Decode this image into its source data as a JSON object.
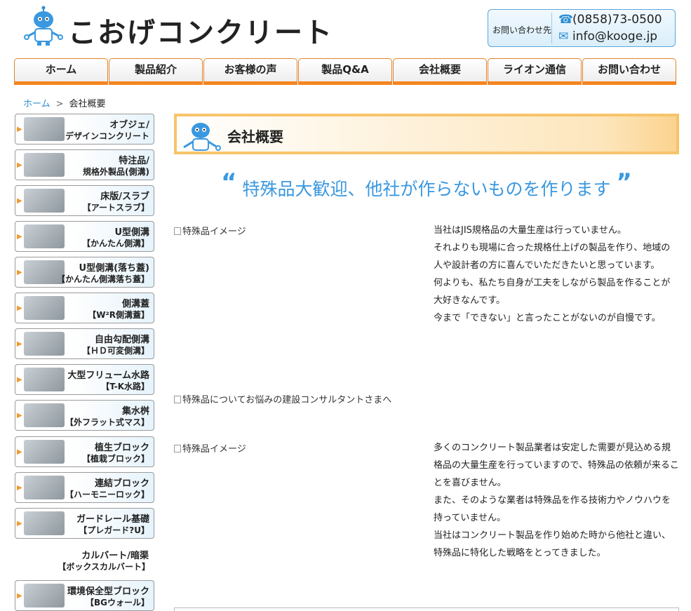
{
  "header": {
    "logo_text": "こおげコンクリート",
    "contact_label": "お問い合わせ先",
    "phone": "(0858)73-0500",
    "email": "info@kooge.jp"
  },
  "nav": [
    {
      "label": "ホーム"
    },
    {
      "label": "製品紹介"
    },
    {
      "label": "お客様の声"
    },
    {
      "label": "製品Q&A"
    },
    {
      "label": "会社概要"
    },
    {
      "label": "ライオン通信"
    },
    {
      "label": "お問い合わせ"
    }
  ],
  "breadcrumb": {
    "home": "ホーム",
    "separator": ">",
    "current": "会社概要"
  },
  "sidebar": [
    {
      "line1": "オブジェ/",
      "line2": "デザインコンクリート"
    },
    {
      "line1": "特注品/",
      "line2": "規格外製品(側溝)"
    },
    {
      "line1": "床版/スラブ",
      "line2": "【アートスラブ】"
    },
    {
      "line1": "U型側溝",
      "line2": "【かんたん側溝】"
    },
    {
      "line1": "U型側溝(落ち蓋)",
      "line2": "【かんたん側溝落ち蓋】"
    },
    {
      "line1": "側溝蓋",
      "line2": "【W²R側溝蓋】"
    },
    {
      "line1": "自由勾配側溝",
      "line2": "【ＨＤ可変側溝】"
    },
    {
      "line1": "大型フリューム水路",
      "line2": "【T-K水路】"
    },
    {
      "line1": "集水桝",
      "line2": "【外フラット式マス】"
    },
    {
      "line1": "植生ブロック",
      "line2": "【植栽ブロック】"
    },
    {
      "line1": "連結ブロック",
      "line2": "【ハーモニーロック】"
    },
    {
      "line1": "ガードレール基礎",
      "line2": "【プレガード?U】"
    },
    {
      "line1": "カルバート/暗渠",
      "line2": "【ボックスカルバート】"
    },
    {
      "line1": "環境保全型ブロック",
      "line2": "【BGウォール】"
    }
  ],
  "main": {
    "title": "会社概要",
    "catchphrase": "特殊品大歓迎、他社が作らないものを作ります",
    "quote_open": "“",
    "quote_close": "”",
    "image1_alt": "特殊品イメージ",
    "paragraph1": [
      "当社はJIS規格品の大量生産は行っていません。",
      "それよりも現場に合った規格仕上げの製品を作り、地域の人や設計者の方に喜んでいただきたいと思っています。",
      "何よりも、私たち自身が工夫をしながら製品を作ることが大好きなんです。",
      "今まで「できない」と言ったことがないのが自慢です。"
    ],
    "banner_alt": "特殊品についてお悩みの建設コンサルタントさまへ",
    "image2_alt": "特殊品イメージ",
    "paragraph2": [
      "多くのコンクリート製品業者は安定した需要が見込める規格品の大量生産を行っていますので、特殊品の依頼が来ることを喜びません。",
      "また、そのような業者は特殊品を作る技術力やノウハウを持っていません。",
      "当社はコンクリート製品を作り始めた時から他社と違い、特殊品に特化した戦略をとってきました。"
    ]
  }
}
